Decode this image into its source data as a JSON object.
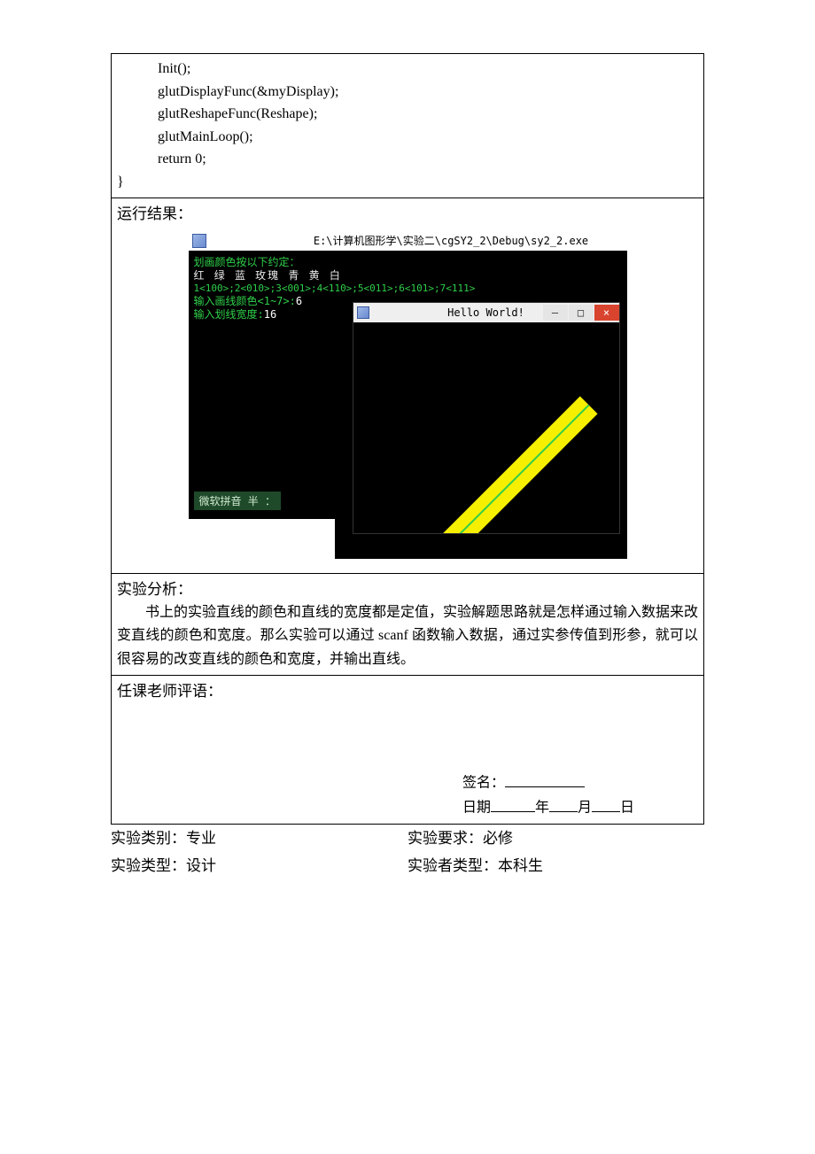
{
  "code": {
    "l1": "Init();",
    "l2": "glutDisplayFunc(&myDisplay);",
    "l3": "glutReshapeFunc(Reshape);",
    "l4": "glutMainLoop();",
    "l5": "return 0;",
    "l6": "}"
  },
  "sections": {
    "run_result": "运行结果：",
    "analysis_label": "实验分析：",
    "analysis_body": "书上的实验直线的颜色和直线的宽度都是定值，实验解题思路就是怎样通过输入数据来改变直线的颜色和宽度。那么实验可以通过 scanf 函数输入数据，通过实参传值到形参，就可以很容易的改变直线的颜色和宽度，并输出直线。",
    "teacher_label": "任课老师评语："
  },
  "console": {
    "title": "E:\\计算机图形学\\实验二\\cgSY2_2\\Debug\\sy2_2.exe",
    "line1": "划画颜色按以下约定：",
    "line2": "  红    绿    蓝    玫瑰    青    黄    白",
    "line3": "1<100>;2<010>;3<001>;4<110>;5<011>;6<101>;7<111>",
    "line4a": "输入画线颜色<1~7>:",
    "line4b": "6",
    "line5a": "输入划线宽度:",
    "line5b": "16",
    "ime": "微软拼音 半 ："
  },
  "hello": {
    "title": "Hello World!",
    "min": "–",
    "max": "□",
    "close": "×"
  },
  "signature": {
    "label": "签名：",
    "date_label": "日期",
    "year": "年",
    "month": "月",
    "day": "日"
  },
  "meta": {
    "row1_left": "实验类别：专业",
    "row1_right": "实验要求：必修",
    "row2_left": "实验类型：设计",
    "row2_right": "实验者类型：本科生"
  }
}
